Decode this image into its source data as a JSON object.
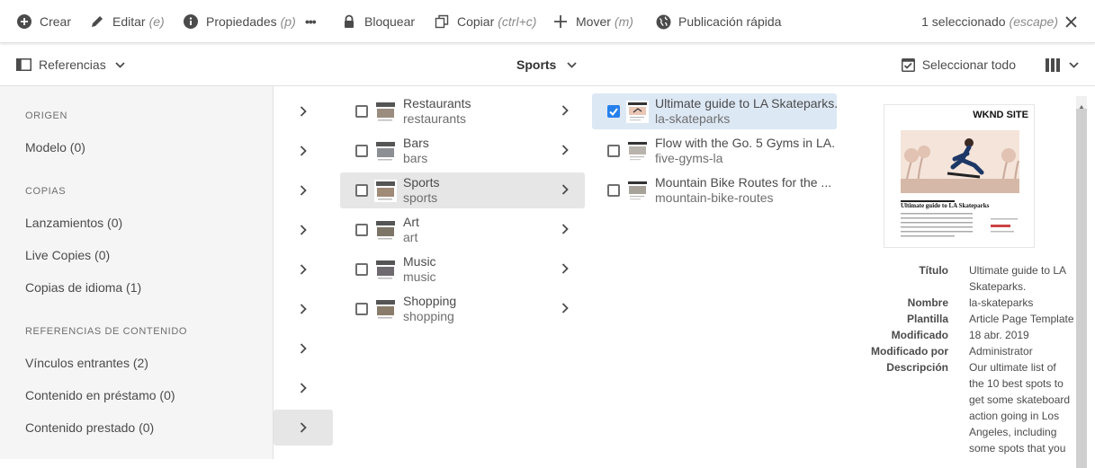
{
  "actions": {
    "create": "Crear",
    "edit": "Editar",
    "edit_hint": "(e)",
    "properties": "Propiedades",
    "properties_hint": "(p)",
    "more": "•••",
    "lock": "Bloquear",
    "copy": "Copiar",
    "copy_hint": "(ctrl+c)",
    "move": "Mover",
    "move_hint": "(m)",
    "quick_publish": "Publicación rápida",
    "selected": "1 seleccionado",
    "selected_hint": "(escape)"
  },
  "toolbar": {
    "rail_toggle": "Referencias",
    "current": "Sports",
    "select_all": "Seleccionar todo"
  },
  "rail": {
    "origin_header": "ORIGEN",
    "model": "Modelo (0)",
    "copies_header": "COPIAS",
    "launches": "Lanzamientos (0)",
    "live_copies": "Live Copies (0)",
    "language_copies": "Copias de idioma (1)",
    "content_refs_header": "REFERENCIAS DE CONTENIDO",
    "incoming_links": "Vínculos entrantes (2)",
    "borrowed_content": "Contenido en préstamo (0)",
    "lent_content": "Contenido prestado (0)"
  },
  "column1": [
    {
      "title": "Restaurants",
      "name": "restaurants"
    },
    {
      "title": "Bars",
      "name": "bars"
    },
    {
      "title": "Sports",
      "name": "sports"
    },
    {
      "title": "Art",
      "name": "art"
    },
    {
      "title": "Music",
      "name": "music"
    },
    {
      "title": "Shopping",
      "name": "shopping"
    }
  ],
  "column2": [
    {
      "title": "Ultimate guide to LA Skateparks.",
      "name": "la-skateparks",
      "selected": true
    },
    {
      "title": "Flow with the Go. 5 Gyms in LA.",
      "name": "five-gyms-la",
      "selected": false
    },
    {
      "title": "Mountain Bike Routes for the ...",
      "name": "mountain-bike-routes",
      "selected": false
    }
  ],
  "preview": {
    "brand": "WKND SITE",
    "heading": "Ultimate guide to LA Skateparks"
  },
  "meta": {
    "title_label": "Título",
    "title_value": "Ultimate guide to LA Skateparks.",
    "name_label": "Nombre",
    "name_value": "la-skateparks",
    "template_label": "Plantilla",
    "template_value": "Article Page Template",
    "modified_label": "Modificado",
    "modified_value": "18 abr. 2019",
    "modified_by_label": "Modificado por",
    "modified_by_value": "Administrator",
    "description_label": "Descripción",
    "description_value": "Our ultimate list of the 10 best spots to get some skateboard action going in Los Angeles, including some spots that you"
  },
  "colors": {
    "accent": "#2680eb",
    "rail_bg": "#f5f5f5",
    "active_row": "#e6e6e6",
    "selected_row": "#dde8f5"
  }
}
